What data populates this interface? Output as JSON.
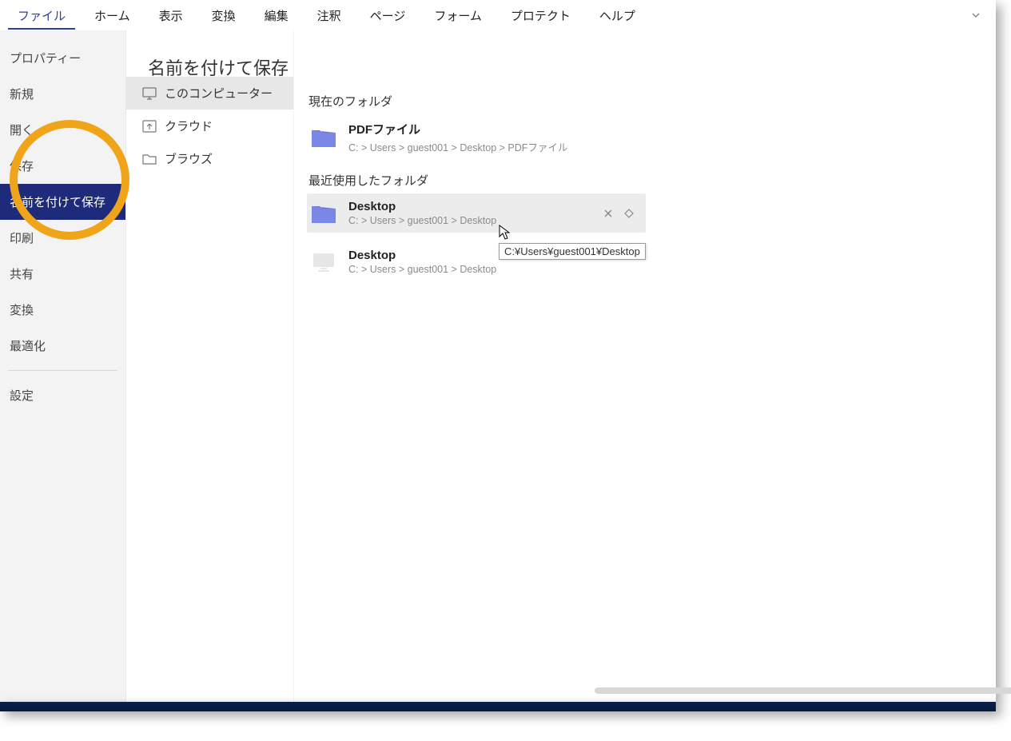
{
  "menubar": {
    "items": [
      {
        "label": "ファイル",
        "active": true
      },
      {
        "label": "ホーム"
      },
      {
        "label": "表示"
      },
      {
        "label": "変換"
      },
      {
        "label": "編集"
      },
      {
        "label": "注釈"
      },
      {
        "label": "ページ"
      },
      {
        "label": "フォーム"
      },
      {
        "label": "プロテクト"
      },
      {
        "label": "ヘルプ"
      }
    ]
  },
  "page_title": "名前を付けて保存",
  "left_menu": {
    "items": [
      {
        "label": "プロパティー"
      },
      {
        "label": "新規"
      },
      {
        "label": "開く"
      },
      {
        "label": "保存"
      },
      {
        "label": "名前を付けて保存",
        "selected": true
      },
      {
        "label": "印刷"
      },
      {
        "label": "共有"
      },
      {
        "label": "変換"
      },
      {
        "label": "最適化"
      }
    ],
    "after_divider": [
      {
        "label": "設定"
      }
    ]
  },
  "locations": {
    "items": [
      {
        "label": "このコンピューター",
        "icon": "monitor",
        "selected": true
      },
      {
        "label": "クラウド",
        "icon": "cloud-up"
      },
      {
        "label": "ブラウズ",
        "icon": "folder-outline"
      }
    ]
  },
  "content": {
    "current_header": "現在のフォルダ",
    "current": {
      "name": "PDFファイル",
      "path": "C: > Users > guest001 > Desktop > PDFファイル"
    },
    "recent_header": "最近使用したフォルダ",
    "recent": [
      {
        "name": "Desktop",
        "path": "C: > Users > guest001 > Desktop",
        "hover": true,
        "kind": "folder"
      },
      {
        "name": "Desktop",
        "path": "C: > Users > guest001 > Desktop",
        "kind": "monitor"
      }
    ]
  },
  "tooltip": "C:¥Users¥guest001¥Desktop"
}
